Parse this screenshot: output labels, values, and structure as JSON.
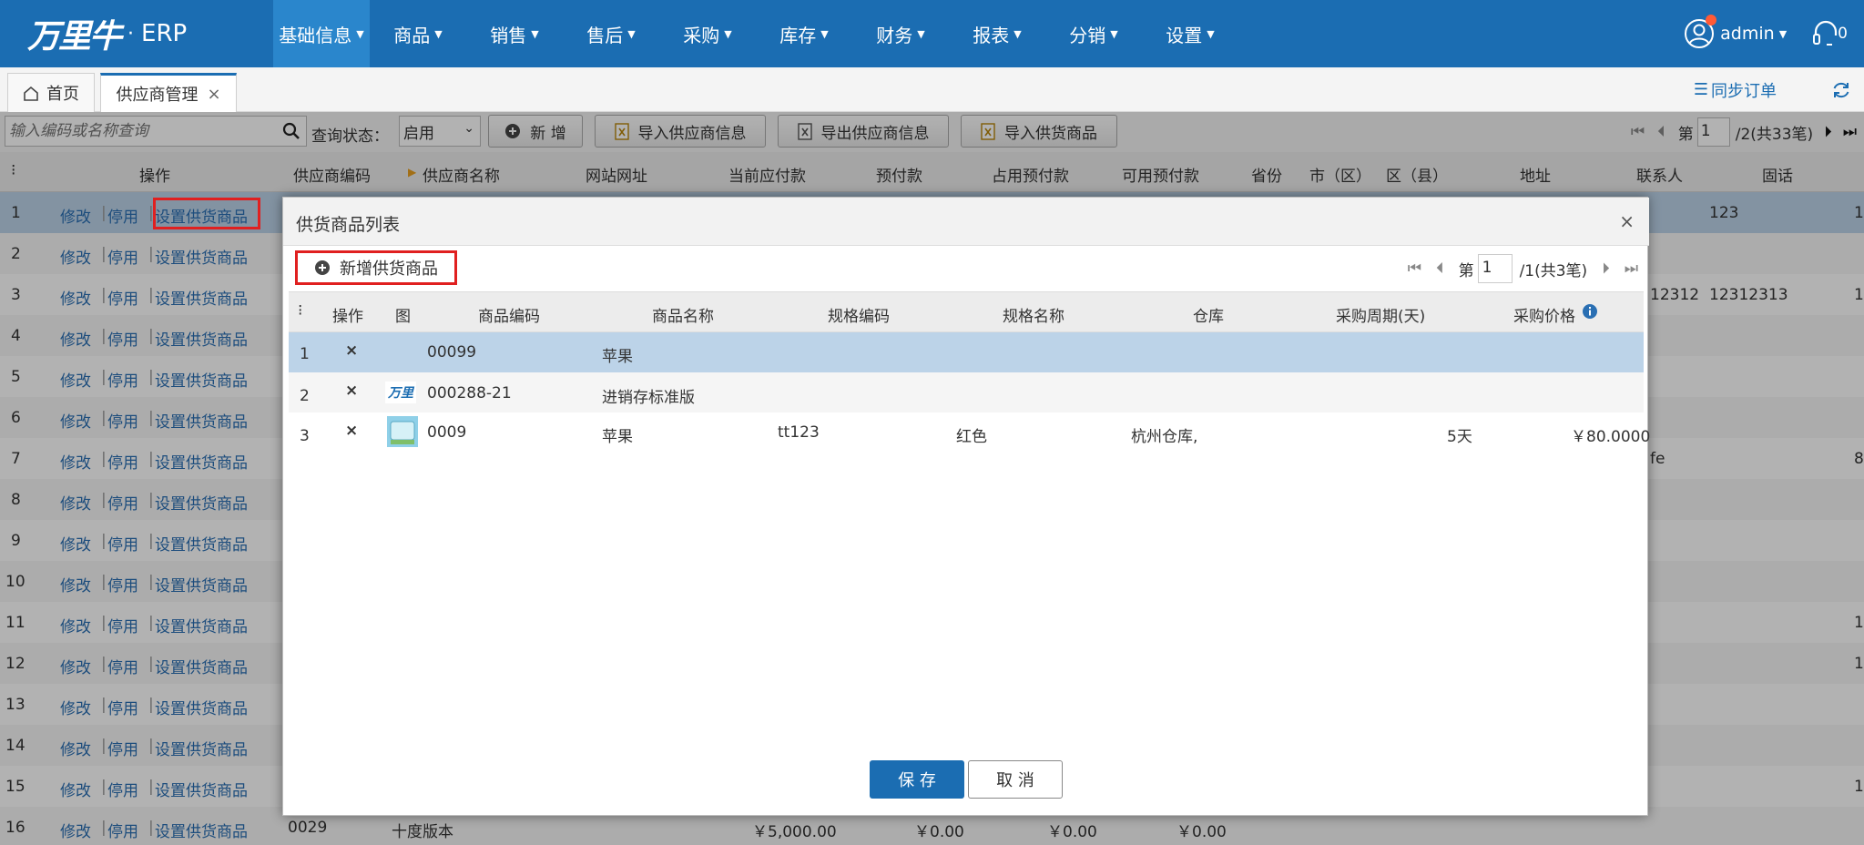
{
  "app": {
    "brand": "万里牛",
    "product": "ERP"
  },
  "menu": [
    {
      "label": "基础信息"
    },
    {
      "label": "商品"
    },
    {
      "label": "销售"
    },
    {
      "label": "售后"
    },
    {
      "label": "采购"
    },
    {
      "label": "库存"
    },
    {
      "label": "财务"
    },
    {
      "label": "报表"
    },
    {
      "label": "分销"
    },
    {
      "label": "设置"
    }
  ],
  "user": {
    "name": "admin",
    "headset_badge": "0"
  },
  "tabs": [
    {
      "label": "首页"
    },
    {
      "label": "供应商管理",
      "close": "×"
    }
  ],
  "tab_actions": {
    "sync_label": "同步订单"
  },
  "toolbar": {
    "search_placeholder": "输入编码或名称查询",
    "status_label": "查询状态：",
    "status_value": "启用",
    "new_label": "新 增",
    "import_supplier": "导入供应商信息",
    "export_supplier": "导出供应商信息",
    "import_goods": "导入供货商品",
    "pager": {
      "page_prefix": "第",
      "page": "1",
      "total": "/2(共33笔)"
    }
  },
  "grid": {
    "columns": [
      "操作",
      "供应商编码",
      "供应商名称",
      "网站网址",
      "当前应付款",
      "预付款",
      "占用预付款",
      "可用预付款",
      "省份",
      "市（区）",
      "区（县）",
      "地址",
      "联系人",
      "固话"
    ],
    "action_edit": "修改",
    "action_disable": "停用",
    "action_goods": "设置供货商品",
    "sep": "|",
    "rows": [
      {
        "no": "1",
        "extra_phone": "123",
        "extra_right": "1"
      },
      {
        "no": "2"
      },
      {
        "no": "3",
        "extra_contact": "12312",
        "extra_phone": "12312313",
        "extra_right": "1"
      },
      {
        "no": "4"
      },
      {
        "no": "5"
      },
      {
        "no": "6"
      },
      {
        "no": "7",
        "extra_contact": "fe",
        "extra_right": "8"
      },
      {
        "no": "8"
      },
      {
        "no": "9"
      },
      {
        "no": "10"
      },
      {
        "no": "11",
        "extra_right": "1"
      },
      {
        "no": "12",
        "extra_right": "1"
      },
      {
        "no": "13"
      },
      {
        "no": "14"
      },
      {
        "no": "15",
        "extra_right": "1"
      },
      {
        "no": "16",
        "code": "0029",
        "name": "十度版本",
        "payable": "￥5,000.00",
        "prepay": "￥0.00",
        "used_prepay": "￥0.00",
        "avail_prepay": "￥0.00"
      }
    ]
  },
  "modal": {
    "title": "供货商品列表",
    "close": "×",
    "add_label": "新增供货商品",
    "pager": {
      "page_prefix": "第",
      "page": "1",
      "total": "/1(共3笔)"
    },
    "columns": [
      "操作",
      "图",
      "商品编码",
      "商品名称",
      "规格编码",
      "规格名称",
      "仓库",
      "采购周期(天)",
      "采购价格"
    ],
    "rows": [
      {
        "no": "1",
        "del": "×",
        "code": "00099",
        "name": "苹果",
        "spec_code": "",
        "spec_name": "",
        "warehouse": "",
        "cycle": "",
        "price": ""
      },
      {
        "no": "2",
        "del": "×",
        "code": "000288-21",
        "name": "进销存标准版",
        "spec_code": "",
        "spec_name": "",
        "warehouse": "",
        "cycle": "",
        "price": ""
      },
      {
        "no": "3",
        "del": "×",
        "code": "0009",
        "name": "苹果",
        "spec_code": "tt123",
        "spec_name": "红色",
        "warehouse": "杭州仓库,",
        "cycle": "5天",
        "price": "￥80.0000"
      }
    ],
    "save_label": "保 存",
    "cancel_label": "取 消"
  },
  "colors": {
    "primary": "#1b6db2",
    "highlight_row": "#bcd3e8",
    "red_box": "#e02020",
    "link": "#2a6fb3"
  }
}
